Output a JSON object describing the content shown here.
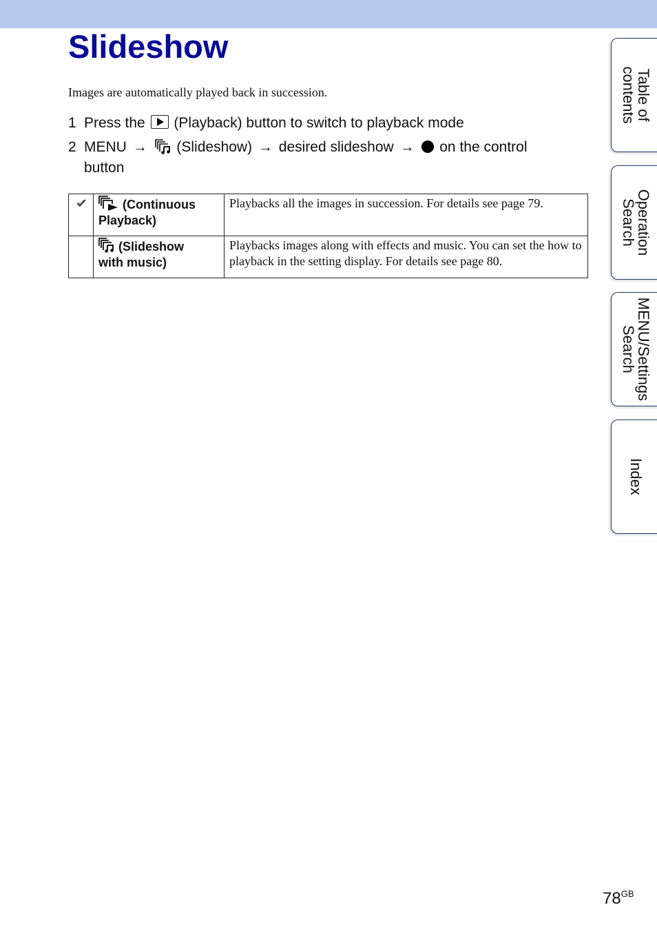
{
  "header": {
    "band_color": "#b8c7ec"
  },
  "page": {
    "title": "Slideshow",
    "title_color": "#0a0a96",
    "intro": "Images are automatically played back in succession."
  },
  "steps": [
    {
      "num": "1",
      "pre": "Press the",
      "icon": "playback-icon",
      "post": "(Playback) button to switch to playback mode"
    },
    {
      "num": "2",
      "menu": "MENU",
      "arrow": "→",
      "icon": "slideshow-icon",
      "slideshow_label": "(Slideshow)",
      "desired": "desired slideshow",
      "control_icon": "filled-circle-icon",
      "tail": "on the control",
      "cont": "button"
    }
  ],
  "table": {
    "rows": [
      {
        "default": true,
        "check_icon": "check-icon",
        "icon": "continuous-playback-icon",
        "name_line1": "(Continuous",
        "name_line2": "Playback)",
        "description": "Playbacks all the images in succession. For details see page 79."
      },
      {
        "default": false,
        "icon": "slideshow-music-icon",
        "name_line1": "(Slideshow",
        "name_line2": "with music)",
        "description": "Playbacks images along with effects and music. You can set the how to playback in the setting display. For details see page 80."
      }
    ]
  },
  "side_tabs": [
    {
      "label": "Table of\ncontents"
    },
    {
      "label": "Operation\nSearch"
    },
    {
      "label": "MENU/Settings\nSearch"
    },
    {
      "label": "Index"
    }
  ],
  "footer": {
    "page_number": "78",
    "suffix": "GB"
  }
}
